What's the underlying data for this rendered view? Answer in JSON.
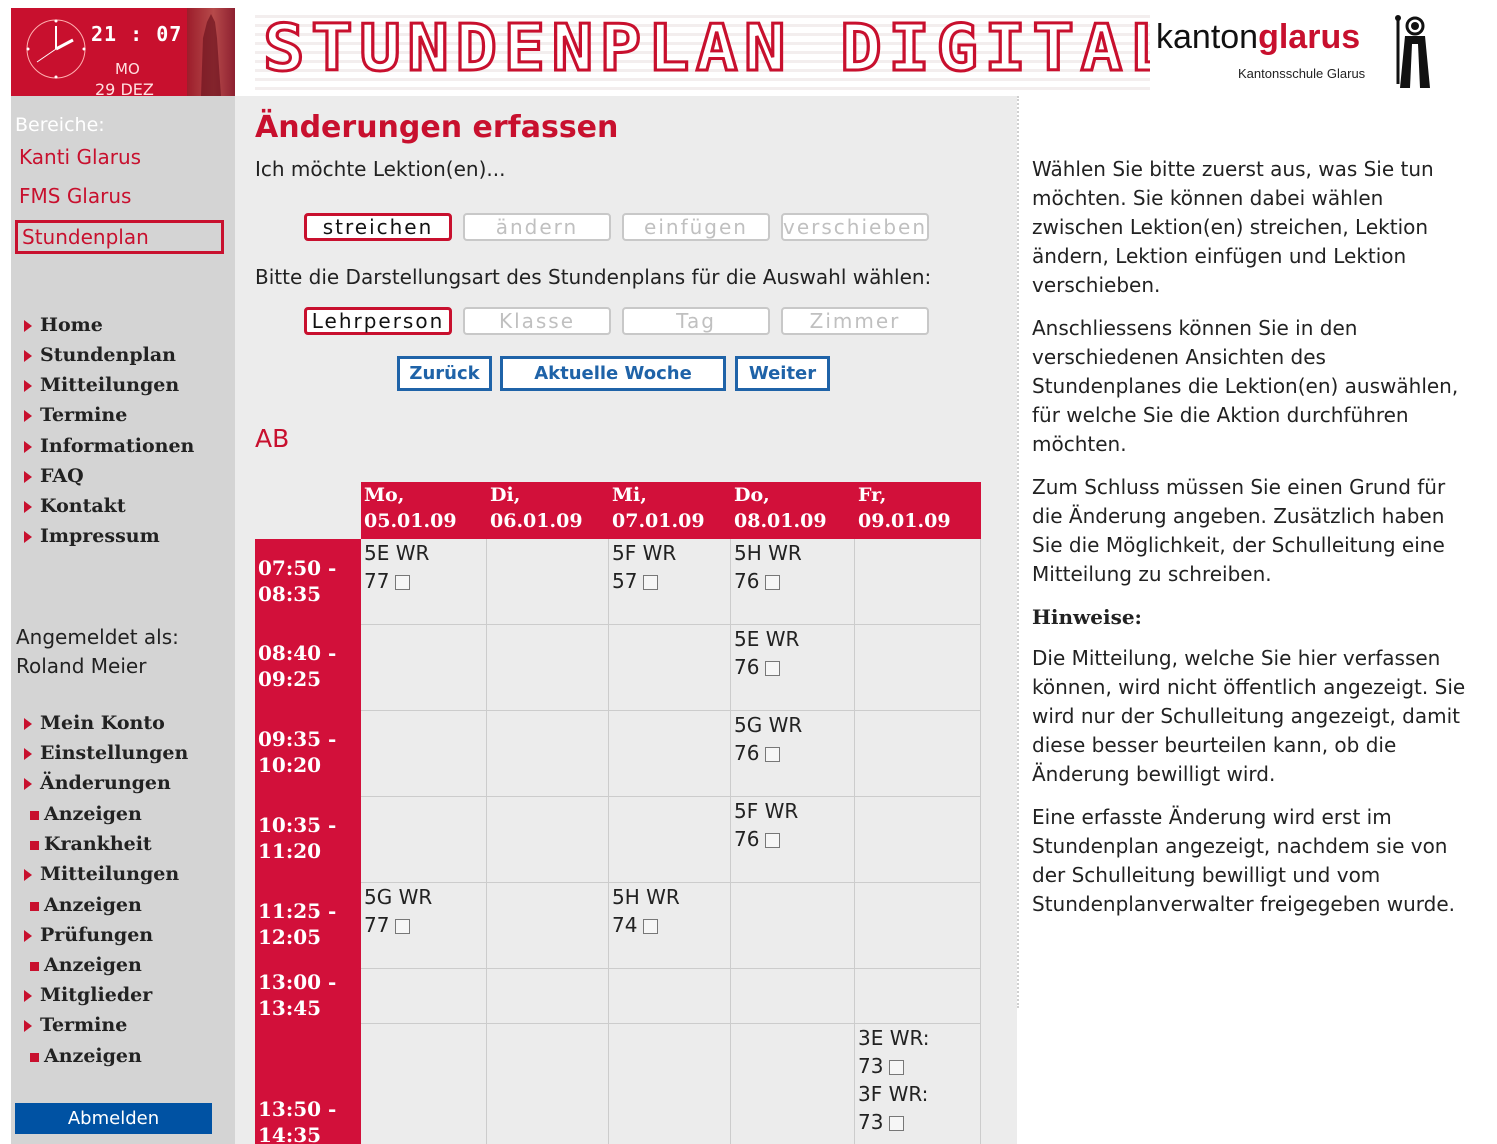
{
  "header": {
    "time": "21 : 07",
    "weekday": "MO",
    "date": "29 DEZ",
    "banner_title": "STUNDENPLAN DIGITAL",
    "logo_kanton": "kanton",
    "logo_glarus": "glarus",
    "logo_school": "Kantonsschule Glarus"
  },
  "sidebar": {
    "areas_label": "Bereiche:",
    "areas": [
      {
        "label": "Kanti Glarus"
      },
      {
        "label": "FMS Glarus"
      },
      {
        "label": "Stundenplan",
        "active": true
      }
    ],
    "nav": [
      {
        "label": "Home"
      },
      {
        "label": "Stundenplan"
      },
      {
        "label": "Mitteilungen"
      },
      {
        "label": "Termine"
      },
      {
        "label": "Informationen"
      },
      {
        "label": "FAQ"
      },
      {
        "label": "Kontakt"
      },
      {
        "label": "Impressum"
      }
    ],
    "logged_in_label": "Angemeldet als:",
    "user_name": "Roland Meier",
    "user_nav": [
      {
        "label": "Mein Konto",
        "type": "main"
      },
      {
        "label": "Einstellungen",
        "type": "main"
      },
      {
        "label": "Änderungen",
        "type": "main"
      },
      {
        "label": "Anzeigen",
        "type": "sub"
      },
      {
        "label": "Krankheit",
        "type": "sub"
      },
      {
        "label": "Mitteilungen",
        "type": "main"
      },
      {
        "label": "Anzeigen",
        "type": "sub"
      },
      {
        "label": "Prüfungen",
        "type": "main"
      },
      {
        "label": "Anzeigen",
        "type": "sub"
      },
      {
        "label": "Mitglieder",
        "type": "main"
      },
      {
        "label": "Termine",
        "type": "main"
      },
      {
        "label": "Anzeigen",
        "type": "sub"
      }
    ],
    "logout_label": "Abmelden"
  },
  "main": {
    "title": "Änderungen erfassen",
    "intro": "Ich möchte Lektion(en)...",
    "actions": [
      "streichen",
      "ändern",
      "einfügen",
      "verschieben"
    ],
    "selected_action": "streichen",
    "view_prompt": "Bitte die Darstellungsart des Stundenplans für die Auswahl wählen:",
    "views": [
      "Lehrperson",
      "Klasse",
      "Tag",
      "Zimmer"
    ],
    "selected_view": "Lehrperson",
    "nav_back": "Zurück",
    "nav_current_week": "Aktuelle Woche",
    "nav_next": "Weiter",
    "person_code": "AB"
  },
  "timetable": {
    "days": [
      {
        "name": "Mo,",
        "date": "05.01.09"
      },
      {
        "name": "Di,",
        "date": "06.01.09"
      },
      {
        "name": "Mi,",
        "date": "07.01.09"
      },
      {
        "name": "Do,",
        "date": "08.01.09"
      },
      {
        "name": "Fr,",
        "date": "09.01.09"
      }
    ],
    "slots": [
      {
        "start": "07:50 -",
        "end": "08:35"
      },
      {
        "start": "08:40 -",
        "end": "09:25"
      },
      {
        "start": "09:35 -",
        "end": "10:20"
      },
      {
        "start": "10:35 -",
        "end": "11:20"
      },
      {
        "start": "11:25 -",
        "end": "12:05"
      },
      {
        "start": "13:00 -",
        "end": "13:45"
      },
      {
        "start": "13:50 -",
        "end": "14:35"
      }
    ],
    "lessons": [
      {
        "day": 0,
        "slot": 0,
        "entries": [
          {
            "label": "5E WR",
            "room": "77"
          }
        ]
      },
      {
        "day": 2,
        "slot": 0,
        "entries": [
          {
            "label": "5F WR",
            "room": "57"
          }
        ]
      },
      {
        "day": 3,
        "slot": 0,
        "entries": [
          {
            "label": "5H WR",
            "room": "76"
          }
        ]
      },
      {
        "day": 3,
        "slot": 1,
        "entries": [
          {
            "label": "5E WR",
            "room": "76"
          }
        ]
      },
      {
        "day": 3,
        "slot": 2,
        "entries": [
          {
            "label": "5G WR",
            "room": "76"
          }
        ]
      },
      {
        "day": 3,
        "slot": 3,
        "entries": [
          {
            "label": "5F WR",
            "room": "76"
          }
        ]
      },
      {
        "day": 0,
        "slot": 4,
        "entries": [
          {
            "label": "5G WR",
            "room": "77"
          }
        ]
      },
      {
        "day": 2,
        "slot": 4,
        "entries": [
          {
            "label": "5H WR",
            "room": "74"
          }
        ]
      },
      {
        "day": 4,
        "slot": 6,
        "entries": [
          {
            "label": "3E WR:",
            "room": "73"
          },
          {
            "label": "3F WR:",
            "room": "73"
          }
        ]
      }
    ]
  },
  "info": {
    "p1": "Wählen Sie bitte zuerst aus, was Sie tun möchten. Sie können dabei wählen zwischen Lektion(en) streichen, Lektion ändern, Lektion einfügen und Lektion verschieben.",
    "p2": "Anschliessens können Sie in den verschiedenen Ansichten des Stundenplanes die Lektion(en) auswählen, für welche Sie die Aktion durchführen möchten.",
    "p3": "Zum Schluss müssen Sie einen Grund für die Änderung angeben. Zusätzlich haben Sie die Möglichkeit, der Schulleitung eine Mitteilung zu schreiben.",
    "hint_heading": "Hinweise:",
    "p4": "Die Mitteilung, welche Sie hier verfassen können, wird nicht öffentlich angezeigt. Sie wird nur der Schulleitung angezeigt, damit diese besser beurteilen kann, ob die Änderung bewilligt wird.",
    "p5": "Eine erfasste Änderung wird erst im Stundenplan angezeigt, nachdem sie von der Schulleitung bewilligt und vom Stundenplanverwalter freigegeben wurde."
  },
  "colors": {
    "brand_red": "#c8102e",
    "header_red": "#d2103a",
    "button_blue": "#1f63a8",
    "logout_blue": "#0052a3"
  }
}
